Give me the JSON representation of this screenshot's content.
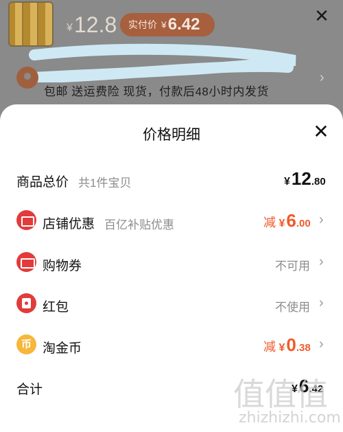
{
  "background": {
    "currency": "¥",
    "price": "12.8",
    "pay_label": "实付价",
    "pay_currency": "¥",
    "pay_value": "6.42",
    "shipping_text": "包邮  送运费险  现货，付款后48小时内发货"
  },
  "sheet": {
    "title": "价格明细",
    "rows": [
      {
        "label": "商品总价",
        "sub": "共1件宝贝",
        "currency": "¥",
        "int": "12",
        "dec": ".80"
      },
      {
        "icon": "shop-discount-icon",
        "label": "店铺优惠",
        "sub": "百亿补贴优惠",
        "prefix": "减",
        "currency": "¥",
        "int": "6",
        "dec": ".00"
      },
      {
        "icon": "coupon-icon",
        "label": "购物券",
        "status": "不可用"
      },
      {
        "icon": "red-packet-icon",
        "label": "红包",
        "status": "不使用"
      },
      {
        "icon": "taojinbi-icon",
        "icon_text": "币",
        "label": "淘金币",
        "prefix": "减",
        "currency": "¥",
        "int": "0",
        "dec": ".38"
      },
      {
        "label": "合计",
        "currency": "¥",
        "int": "6",
        "dec": ".42"
      }
    ]
  },
  "watermark": {
    "glyphs": "值值值",
    "url": "zhizhizhi.com"
  },
  "colors": {
    "accent": "#f05a2a",
    "badge_red": "#e23b3b",
    "coin_gold": "#f6b73c"
  }
}
